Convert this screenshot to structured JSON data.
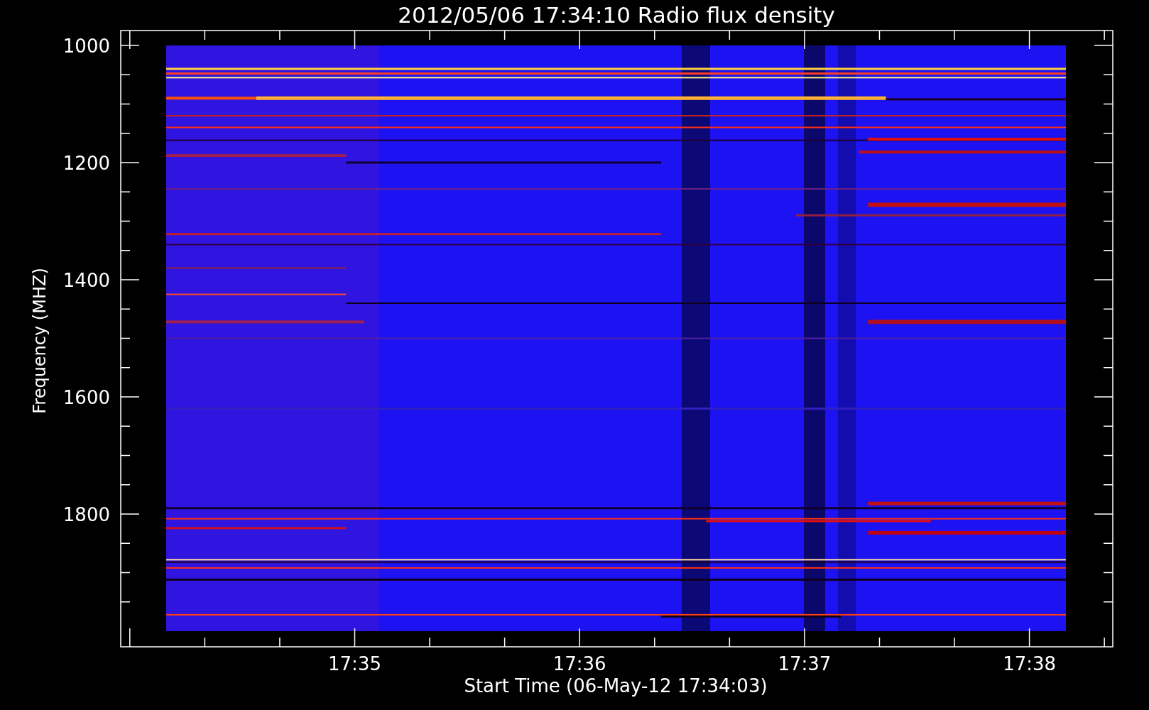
{
  "chart": {
    "title": "2012/05/06 17:34:10 Radio flux density",
    "y_axis": {
      "label": "Frequency (MHZ)",
      "tick_labels": [
        "1000",
        "1200",
        "1400",
        "1600",
        "1800"
      ]
    },
    "x_axis": {
      "label": "Start Time (06-May-12 17:34:03)",
      "tick_labels": [
        "17:35",
        "17:36",
        "17:37",
        "17:38"
      ]
    }
  }
}
